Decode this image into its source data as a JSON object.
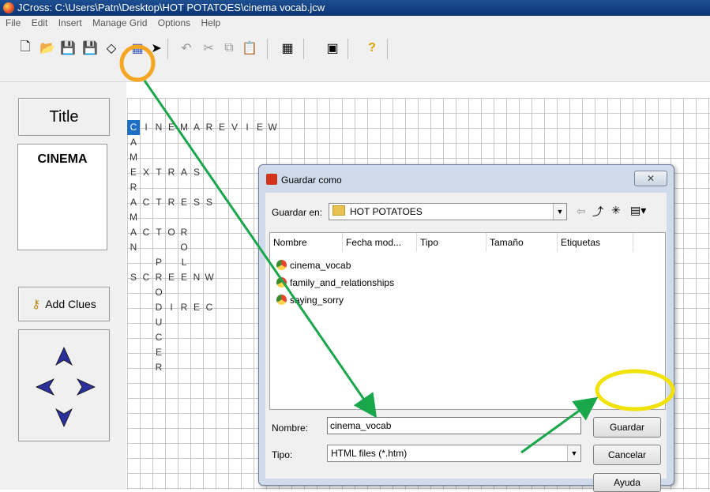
{
  "window": {
    "title": "JCross: C:\\Users\\Patn\\Desktop\\HOT POTATOES\\cinema vocab.jcw"
  },
  "menu": [
    "File",
    "Edit",
    "Insert",
    "Manage Grid",
    "Options",
    "Help"
  ],
  "toolbar": [
    {
      "icon": "new-file-icon",
      "glyph": "🗋"
    },
    {
      "icon": "open-folder-icon",
      "glyph": "📂"
    },
    {
      "icon": "save-icon",
      "glyph": "💾"
    },
    {
      "icon": "save-as-icon",
      "glyph": "💾"
    },
    {
      "icon": "eraser-icon",
      "glyph": "◇"
    },
    {
      "icon": "create-web-page-icon",
      "glyph": "▦"
    },
    {
      "icon": "web-export-arrow-icon",
      "glyph": "➤"
    },
    {
      "icon": "undo-icon",
      "glyph": "↶"
    },
    {
      "icon": "cut-icon",
      "glyph": "✂"
    },
    {
      "icon": "copy-icon",
      "glyph": "⧉"
    },
    {
      "icon": "paste-icon",
      "glyph": "📋"
    },
    {
      "icon": "grid-icon",
      "glyph": "▦"
    },
    {
      "icon": "config-icon",
      "glyph": "▣"
    },
    {
      "icon": "help-icon",
      "glyph": "?"
    }
  ],
  "left_panel": {
    "title_button": "Title",
    "title_value": "CINEMA",
    "add_clues": "Add Clues"
  },
  "grid_letters": [
    {
      "r": 0,
      "c": 0,
      "ch": "C",
      "sel": true
    },
    {
      "r": 0,
      "c": 1,
      "ch": "I"
    },
    {
      "r": 0,
      "c": 2,
      "ch": "N"
    },
    {
      "r": 0,
      "c": 3,
      "ch": "E"
    },
    {
      "r": 0,
      "c": 4,
      "ch": "M"
    },
    {
      "r": 0,
      "c": 5,
      "ch": "A"
    },
    {
      "r": 0,
      "c": 6,
      "ch": "R"
    },
    {
      "r": 0,
      "c": 7,
      "ch": "E"
    },
    {
      "r": 0,
      "c": 8,
      "ch": "V"
    },
    {
      "r": 0,
      "c": 9,
      "ch": "I"
    },
    {
      "r": 0,
      "c": 10,
      "ch": "E"
    },
    {
      "r": 0,
      "c": 11,
      "ch": "W"
    },
    {
      "r": 1,
      "c": 0,
      "ch": "A"
    },
    {
      "r": 2,
      "c": 0,
      "ch": "M"
    },
    {
      "r": 3,
      "c": 0,
      "ch": "E"
    },
    {
      "r": 3,
      "c": 1,
      "ch": "X"
    },
    {
      "r": 3,
      "c": 2,
      "ch": "T"
    },
    {
      "r": 3,
      "c": 3,
      "ch": "R"
    },
    {
      "r": 3,
      "c": 4,
      "ch": "A"
    },
    {
      "r": 3,
      "c": 5,
      "ch": "S"
    },
    {
      "r": 4,
      "c": 0,
      "ch": "R"
    },
    {
      "r": 5,
      "c": 0,
      "ch": "A"
    },
    {
      "r": 5,
      "c": 1,
      "ch": "C"
    },
    {
      "r": 5,
      "c": 2,
      "ch": "T"
    },
    {
      "r": 5,
      "c": 3,
      "ch": "R"
    },
    {
      "r": 5,
      "c": 4,
      "ch": "E"
    },
    {
      "r": 5,
      "c": 5,
      "ch": "S"
    },
    {
      "r": 5,
      "c": 6,
      "ch": "S"
    },
    {
      "r": 6,
      "c": 0,
      "ch": "M"
    },
    {
      "r": 7,
      "c": 0,
      "ch": "A"
    },
    {
      "r": 7,
      "c": 1,
      "ch": "C"
    },
    {
      "r": 7,
      "c": 2,
      "ch": "T"
    },
    {
      "r": 7,
      "c": 3,
      "ch": "O"
    },
    {
      "r": 7,
      "c": 4,
      "ch": "R"
    },
    {
      "r": 8,
      "c": 0,
      "ch": "N"
    },
    {
      "r": 8,
      "c": 4,
      "ch": "O"
    },
    {
      "r": 9,
      "c": 2,
      "ch": "P"
    },
    {
      "r": 9,
      "c": 4,
      "ch": "L"
    },
    {
      "r": 10,
      "c": 0,
      "ch": "S"
    },
    {
      "r": 10,
      "c": 1,
      "ch": "C"
    },
    {
      "r": 10,
      "c": 2,
      "ch": "R"
    },
    {
      "r": 10,
      "c": 3,
      "ch": "E"
    },
    {
      "r": 10,
      "c": 4,
      "ch": "E"
    },
    {
      "r": 10,
      "c": 5,
      "ch": "N"
    },
    {
      "r": 10,
      "c": 6,
      "ch": "W"
    },
    {
      "r": 11,
      "c": 2,
      "ch": "O"
    },
    {
      "r": 12,
      "c": 2,
      "ch": "D"
    },
    {
      "r": 12,
      "c": 3,
      "ch": "I"
    },
    {
      "r": 12,
      "c": 4,
      "ch": "R"
    },
    {
      "r": 12,
      "c": 5,
      "ch": "E"
    },
    {
      "r": 12,
      "c": 6,
      "ch": "C"
    },
    {
      "r": 13,
      "c": 2,
      "ch": "U"
    },
    {
      "r": 14,
      "c": 2,
      "ch": "C"
    },
    {
      "r": 15,
      "c": 2,
      "ch": "E"
    },
    {
      "r": 16,
      "c": 2,
      "ch": "R"
    }
  ],
  "dialog": {
    "title": "Guardar como",
    "close": "✕",
    "save_in_label": "Guardar en:",
    "save_in_value": "HOT POTATOES",
    "columns": [
      "Nombre",
      "Fecha mod...",
      "Tipo",
      "Tamaño",
      "Etiquetas"
    ],
    "files": [
      "cinema_vocab",
      "family_and_relationships",
      "saying_sorry"
    ],
    "name_label": "Nombre:",
    "name_value": "cinema_vocab",
    "type_label": "Tipo:",
    "type_value": "HTML files (*.htm)",
    "save_button": "Guardar",
    "cancel_button": "Cancelar",
    "help_button": "Ayuda"
  },
  "colors": {
    "highlight_orange": "#f5a623",
    "highlight_yellow": "#f0e20a",
    "arrow_green": "#1aa64a",
    "selected_cell": "#1e6fc4"
  }
}
